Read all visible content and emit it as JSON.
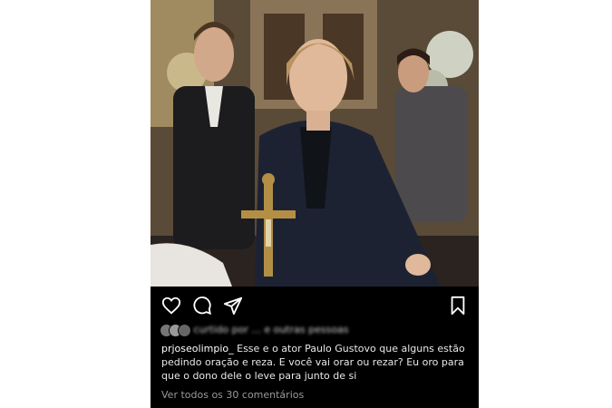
{
  "post": {
    "username": "prjoseolimpio_",
    "caption": "Esse e o ator Paulo Gustovo que alguns estão pedindo oração e reza. E você vai orar ou rezar? Eu oro para que o dono dele o leve para junto de si",
    "likes_text": "curtido por ... e outras pessoas",
    "view_comments": "Ver todos os 30 comentários"
  },
  "icons": {
    "like": "heart-icon",
    "comment": "comment-icon",
    "share": "send-icon",
    "save": "bookmark-icon"
  },
  "colors": {
    "background": "#000000",
    "text": "#e8e8e8",
    "muted": "#9a9a9a"
  }
}
